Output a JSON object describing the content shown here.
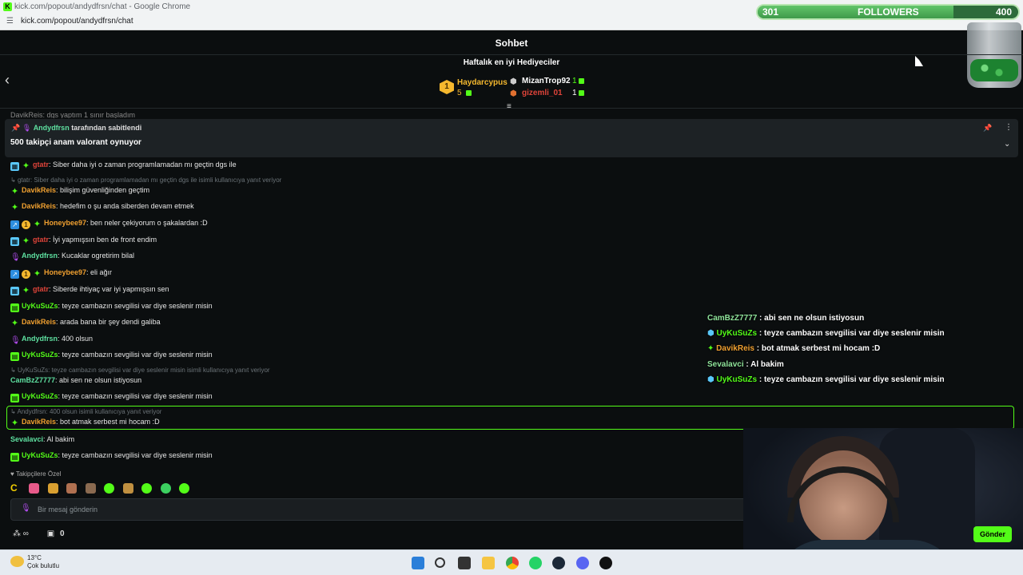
{
  "browser": {
    "window_title": "kick.com/popout/andydfrsn/chat - Google Chrome",
    "url": "kick.com/popout/andydfrsn/chat"
  },
  "followers_bar": {
    "current": "301",
    "label": "FOLLOWERS",
    "goal": "400",
    "progress_fraction": 0.75
  },
  "chat": {
    "header_title": "Sohbet",
    "gifters": {
      "title": "Haftalık en iyi Hediyeciler",
      "top": {
        "rank": "1",
        "name": "Haydarcypus",
        "count": "5"
      },
      "others": [
        {
          "name": "MizanTrop92",
          "count": "1"
        },
        {
          "name": "gizemli_01",
          "count": "1"
        }
      ]
    },
    "cut_message": "DavikReis: dgs yaptım 1 sınır başladım",
    "pinned": {
      "pinned_by_user": "Andydfrsn",
      "pinned_by_suffix": "tarafından sabitlendi",
      "message": "500 takipçi anam valorant oynuyor"
    },
    "messages": [
      {
        "user": "gtatr",
        "text": ": Siber daha iyi o zaman programlamadan mı geçtin dgs ile"
      },
      {
        "reply": "gtatr: Siber daha iyi o zaman programlamadan mı geçtin dgs ile isimli kullanıcıya yanıt veriyor"
      },
      {
        "user": "DavikReis",
        "text": ": bilişim güvenliğinden geçtim"
      },
      {
        "user": "DavikReis",
        "text": ": hedefim o şu anda siberden devam etmek"
      },
      {
        "user": "Honeybee97",
        "text": ": ben neler çekiyorum o şakalardan :D"
      },
      {
        "user": "gtatr",
        "text": ": İyi yapmışsın ben de front endim"
      },
      {
        "user": "Andydfrsn",
        "text": ": Kucaklar ogretirim bilal"
      },
      {
        "user": "Honeybee97",
        "text": ": eli ağır"
      },
      {
        "user": "gtatr",
        "text": ": Siberde ihtiyaç var iyi yapmışsın sen"
      },
      {
        "user": "UyKuSuZs",
        "text": ": teyze cambazın sevgilisi var diye seslenir misin"
      },
      {
        "user": "DavikReis",
        "text": ": arada bana bir şey dendi galiba"
      },
      {
        "user": "Andydfrsn",
        "text": ": 400 olsun"
      },
      {
        "user": "UyKuSuZs",
        "text": ": teyze cambazın sevgilisi var diye seslenir misin"
      },
      {
        "reply": "UyKuSuZs: teyze cambazın sevgilisi var diye seslenir misin isimli kullanıcıya yanıt veriyor"
      },
      {
        "user": "CamBzZ7777",
        "text": ": abi sen ne olsun istiyosun"
      },
      {
        "user": "UyKuSuZs",
        "text": ": teyze cambazın sevgilisi var diye seslenir misin"
      },
      {
        "reply": "Andydfrsn: 400 olsun isimli kullanıcıya yanıt veriyor"
      },
      {
        "user": "DavikReis",
        "text": ": bot atmak serbest mi hocam :D"
      },
      {
        "user": "Sevalavci",
        "text": ": Al bakim"
      },
      {
        "user": "UyKuSuZs",
        "text": ": teyze cambazın sevgilisi var diye seslenir misin"
      }
    ],
    "followers_only_label": "Takipçilere Özel",
    "input_placeholder": "Bir mesaj gönderin",
    "footer_count": "0",
    "send_label": "Gönder"
  },
  "overlay_chat": [
    {
      "user": "CamBzZ7777",
      "text": " : abi sen ne olsun istiyosun"
    },
    {
      "user": "UyKuSuZs",
      "text": " : teyze cambazın sevgilisi var diye seslenir misin"
    },
    {
      "user": "DavikReis",
      "text": " : bot atmak serbest mi hocam :D"
    },
    {
      "user": "Sevalavci",
      "text": " : Al bakim"
    },
    {
      "user": "UyKuSuZs",
      "text": " : teyze cambazın sevgilisi var diye seslenir misin"
    }
  ],
  "taskbar": {
    "weather_temp": "13°C",
    "weather_desc": "Çok bulutlu"
  },
  "colors": {
    "kick_green": "#53fc18",
    "orange_user": "#f0a030",
    "teal_user": "#5ee0a0",
    "red_user": "#e0443a",
    "purple_user": "#b44df2"
  }
}
